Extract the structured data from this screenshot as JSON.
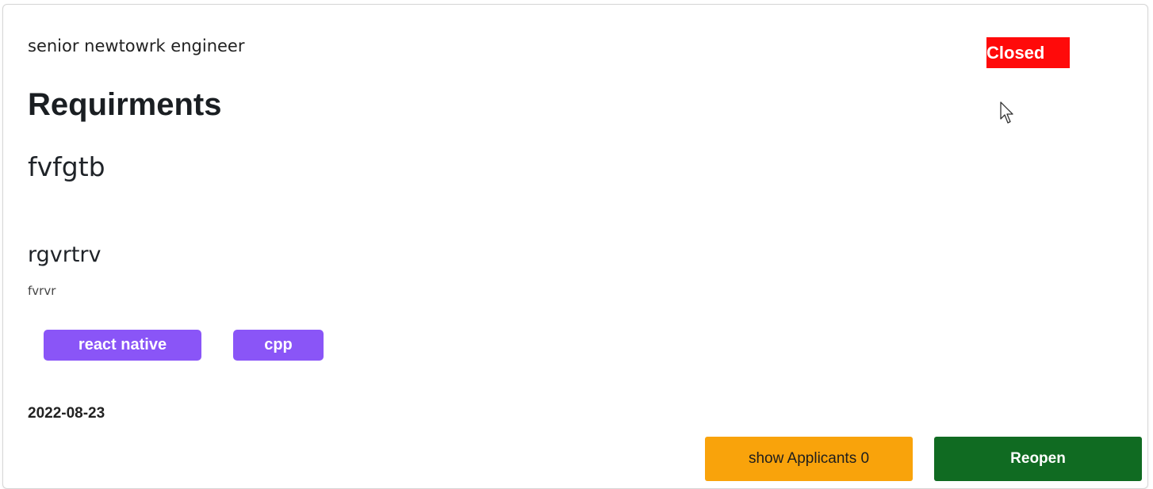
{
  "job": {
    "title": "senior newtowrk engineer",
    "status": "Closed",
    "section_heading": "Requirments",
    "requirement": "fvfgtb",
    "subheading": "rgvrtrv",
    "subtext": "fvrvr",
    "tags": [
      "react native",
      "cpp"
    ],
    "date": "2022-08-23"
  },
  "actions": {
    "applicants_label": "show Applicants 0",
    "reopen_label": "Reopen"
  },
  "colors": {
    "status_closed": "#ff0a0a",
    "tag": "#8a55f7",
    "applicants_button": "#f9a30b",
    "reopen_button": "#106b22"
  },
  "icons": {
    "cursor": "mouse-pointer-icon"
  }
}
